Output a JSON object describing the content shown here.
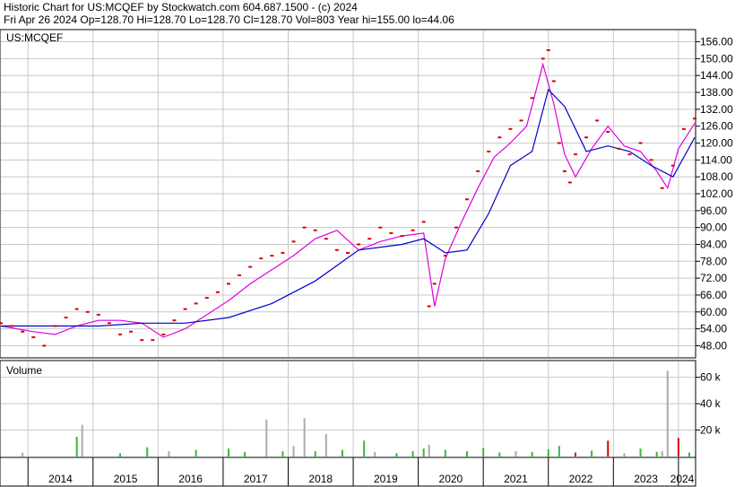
{
  "header": {
    "line1": "Historic Chart for US:MCQEF by Stockwatch.com 604.687.1500 - (c) 2024",
    "line2": "Fri Apr 26 2024   Op=128.70  Hi=128.70  Lo=128.70  Cl=128.70  Vol=803   Year hi=155.00   lo=44.06"
  },
  "colors": {
    "price_bar": "#dd0000",
    "ma_short": "#e000e0",
    "ma_long": "#0000cc",
    "volume_up": "#33bb33",
    "volume_down": "#dd0000",
    "volume_neutral": "#aaaaaa",
    "grid": "#c8c8c8"
  },
  "chart_data": [
    {
      "type": "line",
      "title": "US:MCQEF",
      "x_range": [
        "2013-08",
        "2024-04"
      ],
      "ylim": [
        44,
        160
      ],
      "yticks": [
        48,
        54,
        60,
        66,
        72,
        78,
        84,
        90,
        96,
        102,
        108,
        114,
        120,
        126,
        132,
        138,
        144,
        150,
        156
      ],
      "ytick_labels": [
        "48.00",
        "54.00",
        "60.00",
        "66.00",
        "72.00",
        "78.00",
        "84.00",
        "90.00",
        "96.00",
        "102.00",
        "108.00",
        "114.00",
        "120.00",
        "126.00",
        "132.00",
        "138.00",
        "144.00",
        "150.00",
        "156.00"
      ],
      "grid": true,
      "xtick_labels": [
        "2014",
        "2015",
        "2016",
        "2017",
        "2018",
        "2019",
        "2020",
        "2021",
        "2022",
        "2023",
        "2024"
      ],
      "series": [
        {
          "role": "price",
          "x": [
            "2013-08",
            "2013-10",
            "2013-12",
            "2014-02",
            "2014-04",
            "2014-06",
            "2014-08",
            "2014-10",
            "2014-12",
            "2015-02",
            "2015-04",
            "2015-06",
            "2015-08",
            "2015-10",
            "2015-12",
            "2016-02",
            "2016-04",
            "2016-06",
            "2016-08",
            "2016-10",
            "2016-12",
            "2017-02",
            "2017-04",
            "2017-06",
            "2017-08",
            "2017-10",
            "2017-12",
            "2018-02",
            "2018-04",
            "2018-06",
            "2018-08",
            "2018-10",
            "2018-12",
            "2019-02",
            "2019-04",
            "2019-06",
            "2019-08",
            "2019-10",
            "2019-12",
            "2020-02",
            "2020-03",
            "2020-04",
            "2020-06",
            "2020-08",
            "2020-10",
            "2020-12",
            "2021-02",
            "2021-04",
            "2021-06",
            "2021-08",
            "2021-10",
            "2021-12",
            "2022-01",
            "2022-02",
            "2022-03",
            "2022-04",
            "2022-05",
            "2022-06",
            "2022-08",
            "2022-10",
            "2022-12",
            "2023-02",
            "2023-04",
            "2023-06",
            "2023-08",
            "2023-10",
            "2023-12",
            "2024-02",
            "2024-04"
          ],
          "values": [
            56,
            55,
            53,
            51,
            48,
            55,
            58,
            61,
            60,
            59,
            56,
            52,
            53,
            50,
            50,
            52,
            57,
            61,
            63,
            65,
            67,
            70,
            73,
            76,
            79,
            80,
            81,
            85,
            90,
            89,
            86,
            82,
            81,
            84,
            86,
            90,
            88,
            87,
            89,
            92,
            62,
            70,
            80,
            90,
            100,
            110,
            117,
            122,
            125,
            128,
            136,
            150,
            153,
            142,
            120,
            110,
            106,
            116,
            122,
            128,
            124,
            118,
            116,
            120,
            114,
            104,
            112,
            125,
            128.7
          ]
        },
        {
          "role": "moving-average-short",
          "x": [
            "2013-08",
            "2014-02",
            "2014-06",
            "2014-10",
            "2015-02",
            "2015-06",
            "2015-10",
            "2016-02",
            "2016-06",
            "2016-10",
            "2017-02",
            "2017-06",
            "2017-10",
            "2018-02",
            "2018-06",
            "2018-10",
            "2019-02",
            "2019-06",
            "2019-10",
            "2020-02",
            "2020-04",
            "2020-06",
            "2020-09",
            "2020-12",
            "2021-03",
            "2021-06",
            "2021-09",
            "2021-12",
            "2022-02",
            "2022-04",
            "2022-06",
            "2022-09",
            "2022-12",
            "2023-03",
            "2023-06",
            "2023-09",
            "2023-11",
            "2024-01",
            "2024-04"
          ],
          "values": [
            55,
            53,
            52,
            55,
            57,
            57,
            56,
            51,
            54,
            59,
            64,
            70,
            75,
            80,
            86,
            89,
            82,
            85,
            87,
            88,
            62,
            79,
            92,
            104,
            115,
            120,
            126,
            148,
            134,
            116,
            108,
            118,
            126,
            119,
            117,
            110,
            104,
            118,
            127
          ]
        },
        {
          "role": "moving-average-long",
          "x": [
            "2013-08",
            "2014-06",
            "2015-02",
            "2015-10",
            "2016-06",
            "2017-02",
            "2017-10",
            "2018-06",
            "2019-02",
            "2019-10",
            "2020-02",
            "2020-06",
            "2020-10",
            "2021-02",
            "2021-06",
            "2021-10",
            "2022-01",
            "2022-04",
            "2022-08",
            "2022-12",
            "2023-04",
            "2023-08",
            "2023-12",
            "2024-04"
          ],
          "values": [
            55,
            55,
            55,
            56,
            56,
            58,
            63,
            71,
            82,
            84,
            86,
            81,
            82,
            95,
            112,
            117,
            139,
            133,
            117,
            119,
            117,
            112,
            108,
            122
          ]
        }
      ]
    },
    {
      "type": "bar",
      "title": "Volume",
      "ylim": [
        0,
        72000
      ],
      "yticks": [
        20000,
        40000,
        60000
      ],
      "ytick_labels": [
        "20 k",
        "40 k",
        "60 k"
      ],
      "x": [
        "2013-12",
        "2014-10",
        "2014-11",
        "2015-06",
        "2015-11",
        "2016-03",
        "2016-08",
        "2017-02",
        "2017-05",
        "2017-09",
        "2017-12",
        "2018-02",
        "2018-04",
        "2018-06",
        "2018-08",
        "2018-11",
        "2019-03",
        "2019-05",
        "2019-09",
        "2019-12",
        "2020-02",
        "2020-03",
        "2020-06",
        "2020-10",
        "2021-01",
        "2021-04",
        "2021-07",
        "2021-10",
        "2022-01",
        "2022-03",
        "2022-06",
        "2022-09",
        "2022-12",
        "2023-03",
        "2023-06",
        "2023-09",
        "2023-10",
        "2023-11",
        "2024-01",
        "2024-03"
      ],
      "values": [
        3000,
        15000,
        24000,
        2500,
        7000,
        4000,
        5000,
        6000,
        3500,
        28000,
        4000,
        8000,
        29000,
        4000,
        17000,
        5000,
        12000,
        3500,
        2500,
        4000,
        6000,
        9000,
        5000,
        4000,
        6500,
        3000,
        4000,
        3500,
        5500,
        8000,
        3000,
        4500,
        12000,
        2500,
        6000,
        3500,
        4000,
        65000,
        14000,
        3000
      ],
      "direction": [
        "neutral",
        "up",
        "neutral",
        "up",
        "up",
        "neutral",
        "up",
        "up",
        "up",
        "neutral",
        "up",
        "neutral",
        "neutral",
        "up",
        "neutral",
        "up",
        "up",
        "neutral",
        "up",
        "up",
        "up",
        "neutral",
        "up",
        "up",
        "up",
        "up",
        "neutral",
        "up",
        "up",
        "up",
        "down",
        "up",
        "down",
        "neutral",
        "up",
        "up",
        "neutral",
        "neutral",
        "down",
        "up"
      ]
    }
  ]
}
